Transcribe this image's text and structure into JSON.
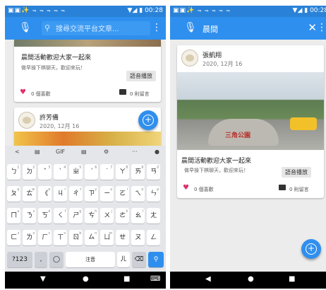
{
  "status": {
    "icons": "▣▣✨ ⫬ ⫬ ⫬ ⫬ ⫬",
    "time": "00:28",
    "signal": "▼◢ ▮"
  },
  "left": {
    "search": {
      "placeholder": "搜尋交流平台文章..."
    },
    "post1": {
      "title": "晨間活動歡迎大家一起來",
      "body": "做早操下棋聊天，歡迎來玩！",
      "tag": "語音播放",
      "likes": "0 個喜歡",
      "comments": "0 則留言"
    },
    "post2": {
      "author": "許芳備",
      "date": "2020, 12月 16"
    }
  },
  "keyboard": {
    "toolbar": [
      "<",
      "GIF",
      "⚙",
      "···"
    ],
    "rows": [
      [
        [
          "ㄅ",
          "1"
        ],
        [
          "ㄉ",
          "2"
        ],
        [
          "ˇ",
          "3"
        ],
        [
          "ˋ",
          "4"
        ],
        [
          "ㄓ",
          "5"
        ],
        [
          "ˊ",
          "6"
        ],
        [
          "˙",
          "7"
        ],
        [
          "ㄚ",
          "8"
        ],
        [
          "ㄞ",
          "9"
        ],
        [
          "ㄢ",
          "0"
        ]
      ],
      [
        [
          "ㄆ",
          "q"
        ],
        [
          "ㄊ",
          "w"
        ],
        [
          "《",
          "e"
        ],
        [
          "ㄐ",
          "r"
        ],
        [
          "ㄔ",
          "t"
        ],
        [
          "ㄗ",
          "y"
        ],
        [
          "ㄧ",
          "u"
        ],
        [
          "ㄛ",
          "i"
        ],
        [
          "ㄟ",
          "o"
        ],
        [
          "ㄣ",
          "p"
        ]
      ],
      [
        [
          "ㄇ",
          "a"
        ],
        [
          "ㄋ",
          "s"
        ],
        [
          "ㄎ",
          "d"
        ],
        [
          "ㄑ",
          "f"
        ],
        [
          "ㄕ",
          "g"
        ],
        [
          "ㄘ",
          "h"
        ],
        [
          "ㄨ",
          "j"
        ],
        [
          "ㄜ",
          "k"
        ],
        [
          "ㄠ",
          "l"
        ],
        [
          "ㄤ",
          ""
        ]
      ],
      [
        [
          "ㄈ",
          "z"
        ],
        [
          "ㄌ",
          "x"
        ],
        [
          "ㄏ",
          "c"
        ],
        [
          "ㄒ",
          "v"
        ],
        [
          "ㄖ",
          "b"
        ],
        [
          "ㄙ",
          "n"
        ],
        [
          "ㄩ",
          "m"
        ],
        [
          "ㄝ",
          ""
        ],
        [
          "ㄡ",
          ""
        ],
        [
          "ㄥ",
          ""
        ]
      ]
    ],
    "bottom": {
      "mode": "?123",
      "lang": "注音",
      "er": "ㄦ"
    }
  },
  "right": {
    "title": "晨間",
    "post": {
      "author": "張凱翔",
      "date": "2020, 12月 16",
      "sign": "三角公園",
      "title": "晨間活動歡迎大家一起來",
      "body": "做早操下棋聊天，歡迎來玩！",
      "tag": "語音播放",
      "likes": "0 個喜歡",
      "comments": "0 則留言"
    }
  },
  "colors": {
    "appbar": "#2f8fee",
    "statusbar": "#2a82d8",
    "like": "#e0306b"
  }
}
